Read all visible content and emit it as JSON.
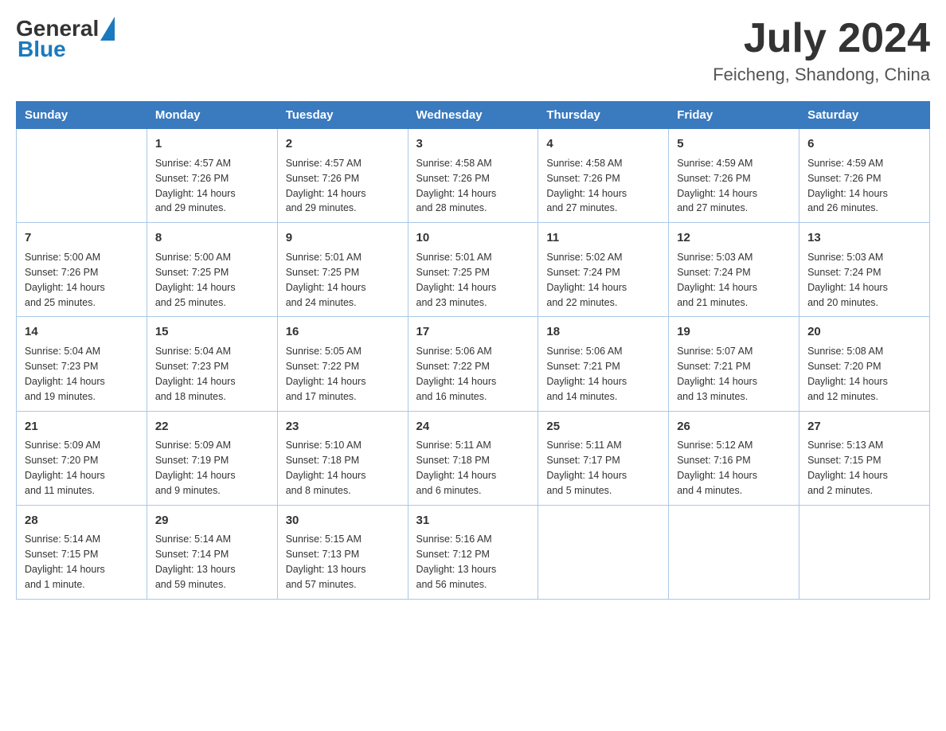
{
  "logo": {
    "general": "General",
    "triangle": "",
    "blue": "Blue"
  },
  "title": "July 2024",
  "subtitle": "Feicheng, Shandong, China",
  "headers": [
    "Sunday",
    "Monday",
    "Tuesday",
    "Wednesday",
    "Thursday",
    "Friday",
    "Saturday"
  ],
  "weeks": [
    [
      {
        "day": "",
        "info": ""
      },
      {
        "day": "1",
        "info": "Sunrise: 4:57 AM\nSunset: 7:26 PM\nDaylight: 14 hours\nand 29 minutes."
      },
      {
        "day": "2",
        "info": "Sunrise: 4:57 AM\nSunset: 7:26 PM\nDaylight: 14 hours\nand 29 minutes."
      },
      {
        "day": "3",
        "info": "Sunrise: 4:58 AM\nSunset: 7:26 PM\nDaylight: 14 hours\nand 28 minutes."
      },
      {
        "day": "4",
        "info": "Sunrise: 4:58 AM\nSunset: 7:26 PM\nDaylight: 14 hours\nand 27 minutes."
      },
      {
        "day": "5",
        "info": "Sunrise: 4:59 AM\nSunset: 7:26 PM\nDaylight: 14 hours\nand 27 minutes."
      },
      {
        "day": "6",
        "info": "Sunrise: 4:59 AM\nSunset: 7:26 PM\nDaylight: 14 hours\nand 26 minutes."
      }
    ],
    [
      {
        "day": "7",
        "info": "Sunrise: 5:00 AM\nSunset: 7:26 PM\nDaylight: 14 hours\nand 25 minutes."
      },
      {
        "day": "8",
        "info": "Sunrise: 5:00 AM\nSunset: 7:25 PM\nDaylight: 14 hours\nand 25 minutes."
      },
      {
        "day": "9",
        "info": "Sunrise: 5:01 AM\nSunset: 7:25 PM\nDaylight: 14 hours\nand 24 minutes."
      },
      {
        "day": "10",
        "info": "Sunrise: 5:01 AM\nSunset: 7:25 PM\nDaylight: 14 hours\nand 23 minutes."
      },
      {
        "day": "11",
        "info": "Sunrise: 5:02 AM\nSunset: 7:24 PM\nDaylight: 14 hours\nand 22 minutes."
      },
      {
        "day": "12",
        "info": "Sunrise: 5:03 AM\nSunset: 7:24 PM\nDaylight: 14 hours\nand 21 minutes."
      },
      {
        "day": "13",
        "info": "Sunrise: 5:03 AM\nSunset: 7:24 PM\nDaylight: 14 hours\nand 20 minutes."
      }
    ],
    [
      {
        "day": "14",
        "info": "Sunrise: 5:04 AM\nSunset: 7:23 PM\nDaylight: 14 hours\nand 19 minutes."
      },
      {
        "day": "15",
        "info": "Sunrise: 5:04 AM\nSunset: 7:23 PM\nDaylight: 14 hours\nand 18 minutes."
      },
      {
        "day": "16",
        "info": "Sunrise: 5:05 AM\nSunset: 7:22 PM\nDaylight: 14 hours\nand 17 minutes."
      },
      {
        "day": "17",
        "info": "Sunrise: 5:06 AM\nSunset: 7:22 PM\nDaylight: 14 hours\nand 16 minutes."
      },
      {
        "day": "18",
        "info": "Sunrise: 5:06 AM\nSunset: 7:21 PM\nDaylight: 14 hours\nand 14 minutes."
      },
      {
        "day": "19",
        "info": "Sunrise: 5:07 AM\nSunset: 7:21 PM\nDaylight: 14 hours\nand 13 minutes."
      },
      {
        "day": "20",
        "info": "Sunrise: 5:08 AM\nSunset: 7:20 PM\nDaylight: 14 hours\nand 12 minutes."
      }
    ],
    [
      {
        "day": "21",
        "info": "Sunrise: 5:09 AM\nSunset: 7:20 PM\nDaylight: 14 hours\nand 11 minutes."
      },
      {
        "day": "22",
        "info": "Sunrise: 5:09 AM\nSunset: 7:19 PM\nDaylight: 14 hours\nand 9 minutes."
      },
      {
        "day": "23",
        "info": "Sunrise: 5:10 AM\nSunset: 7:18 PM\nDaylight: 14 hours\nand 8 minutes."
      },
      {
        "day": "24",
        "info": "Sunrise: 5:11 AM\nSunset: 7:18 PM\nDaylight: 14 hours\nand 6 minutes."
      },
      {
        "day": "25",
        "info": "Sunrise: 5:11 AM\nSunset: 7:17 PM\nDaylight: 14 hours\nand 5 minutes."
      },
      {
        "day": "26",
        "info": "Sunrise: 5:12 AM\nSunset: 7:16 PM\nDaylight: 14 hours\nand 4 minutes."
      },
      {
        "day": "27",
        "info": "Sunrise: 5:13 AM\nSunset: 7:15 PM\nDaylight: 14 hours\nand 2 minutes."
      }
    ],
    [
      {
        "day": "28",
        "info": "Sunrise: 5:14 AM\nSunset: 7:15 PM\nDaylight: 14 hours\nand 1 minute."
      },
      {
        "day": "29",
        "info": "Sunrise: 5:14 AM\nSunset: 7:14 PM\nDaylight: 13 hours\nand 59 minutes."
      },
      {
        "day": "30",
        "info": "Sunrise: 5:15 AM\nSunset: 7:13 PM\nDaylight: 13 hours\nand 57 minutes."
      },
      {
        "day": "31",
        "info": "Sunrise: 5:16 AM\nSunset: 7:12 PM\nDaylight: 13 hours\nand 56 minutes."
      },
      {
        "day": "",
        "info": ""
      },
      {
        "day": "",
        "info": ""
      },
      {
        "day": "",
        "info": ""
      }
    ]
  ]
}
